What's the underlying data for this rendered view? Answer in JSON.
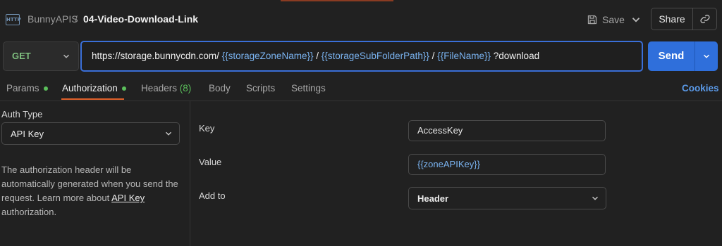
{
  "header": {
    "breadcrumb_parent": "BunnyAPIS",
    "breadcrumb_sep": "/",
    "title": "04-Video-Download-Link",
    "http_icon_text": "HTTP",
    "save_label": "Save",
    "share_label": "Share"
  },
  "request": {
    "method": "GET",
    "url_parts": {
      "base": "https://storage.bunnycdn.com/",
      "var1": "{{storageZoneName}}",
      "sep1": "/",
      "var2": "{{storageSubFolderPath}}",
      "sep2": "/",
      "var3": "{{FileName}}",
      "suffix": "?download"
    },
    "send_label": "Send"
  },
  "tabs": {
    "params": "Params",
    "authorization": "Authorization",
    "headers": "Headers",
    "headers_count": "(8)",
    "body": "Body",
    "scripts": "Scripts",
    "settings": "Settings",
    "cookies": "Cookies"
  },
  "auth": {
    "type_label": "Auth Type",
    "type_value": "API Key",
    "desc_pre": "The authorization header will be automatically generated when you send the request. Learn more about",
    "desc_link": "API Key",
    "desc_post": "authorization."
  },
  "form": {
    "key_label": "Key",
    "key_value": "AccessKey",
    "value_label": "Value",
    "value_value": "{{zoneAPIKey}}",
    "addto_label": "Add to",
    "addto_value": "Header"
  },
  "colors": {
    "accent": "#2f6fdb",
    "tab_active_underline": "#e0612b",
    "variable": "#7ab3f0",
    "status_dot": "#5bbf5b"
  }
}
